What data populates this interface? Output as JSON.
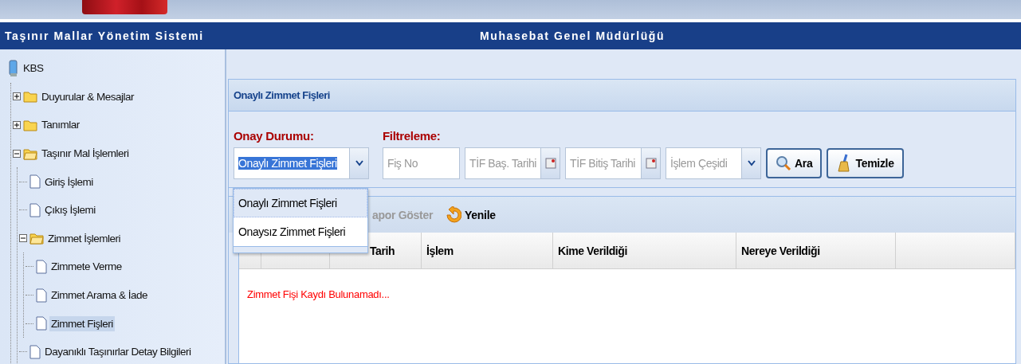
{
  "header": {
    "title": "Taşınır Mallar Yönetim Sistemi",
    "organization": "Muhasebat Genel Müdürlüğü"
  },
  "tree": {
    "root": "KBS",
    "items": [
      {
        "kind": "folder",
        "label": "Duyurular & Mesajlar",
        "expanded": false,
        "selected": false
      },
      {
        "kind": "folder",
        "label": "Tanımlar",
        "expanded": false,
        "selected": false
      },
      {
        "kind": "folder",
        "label": "Taşınır Mal İşlemleri",
        "expanded": true,
        "selected": false,
        "children": [
          {
            "kind": "file",
            "label": "Giriş İşlemi",
            "selected": false
          },
          {
            "kind": "file",
            "label": "Çıkış İşlemi",
            "selected": false
          },
          {
            "kind": "folder",
            "label": "Zimmet İşlemleri",
            "expanded": true,
            "selected": false,
            "children": [
              {
                "kind": "file",
                "label": "Zimmete Verme",
                "selected": false
              },
              {
                "kind": "file",
                "label": "Zimmet Arama & İade",
                "selected": false
              },
              {
                "kind": "file",
                "label": "Zimmet Fişleri",
                "selected": true
              }
            ]
          },
          {
            "kind": "file",
            "label": "Dayanıklı Taşınırlar Detay Bilgileri",
            "selected": false
          }
        ]
      }
    ]
  },
  "panel": {
    "title": "Onaylı Zimmet Fişleri",
    "status_label": "Onay Durumu:",
    "filter_label": "Filtreleme:",
    "status_combo": {
      "value": "Onaylı Zimmet Fişleri",
      "expanded": true,
      "options": [
        {
          "label": "Onaylı Zimmet Fişleri",
          "selected": true
        },
        {
          "label": "Onaysız Zimmet Fişleri",
          "selected": false
        }
      ]
    },
    "filters": [
      {
        "kind": "text",
        "placeholder": "Fiş No"
      },
      {
        "kind": "date",
        "placeholder": "TİF Baş. Tarihi"
      },
      {
        "kind": "date",
        "placeholder": "TİF Bitiş Tarihi"
      },
      {
        "kind": "combo",
        "placeholder": "İşlem Çeşidi"
      }
    ],
    "buttons": [
      {
        "kind": "search",
        "label": "Ara"
      },
      {
        "kind": "clear",
        "label": "Temizle"
      }
    ],
    "toolbar": [
      {
        "kind": "report",
        "label": "apor Göster",
        "disabled": true
      },
      {
        "kind": "refresh",
        "label": "Yenile",
        "disabled": false
      }
    ],
    "columns": [
      "",
      "",
      "Tarih",
      "İşlem",
      "Kime Verildiği",
      "Nereye Verildiği",
      ""
    ],
    "empty_message": "Zimmet Fişi Kaydı Bulunamadı..."
  }
}
